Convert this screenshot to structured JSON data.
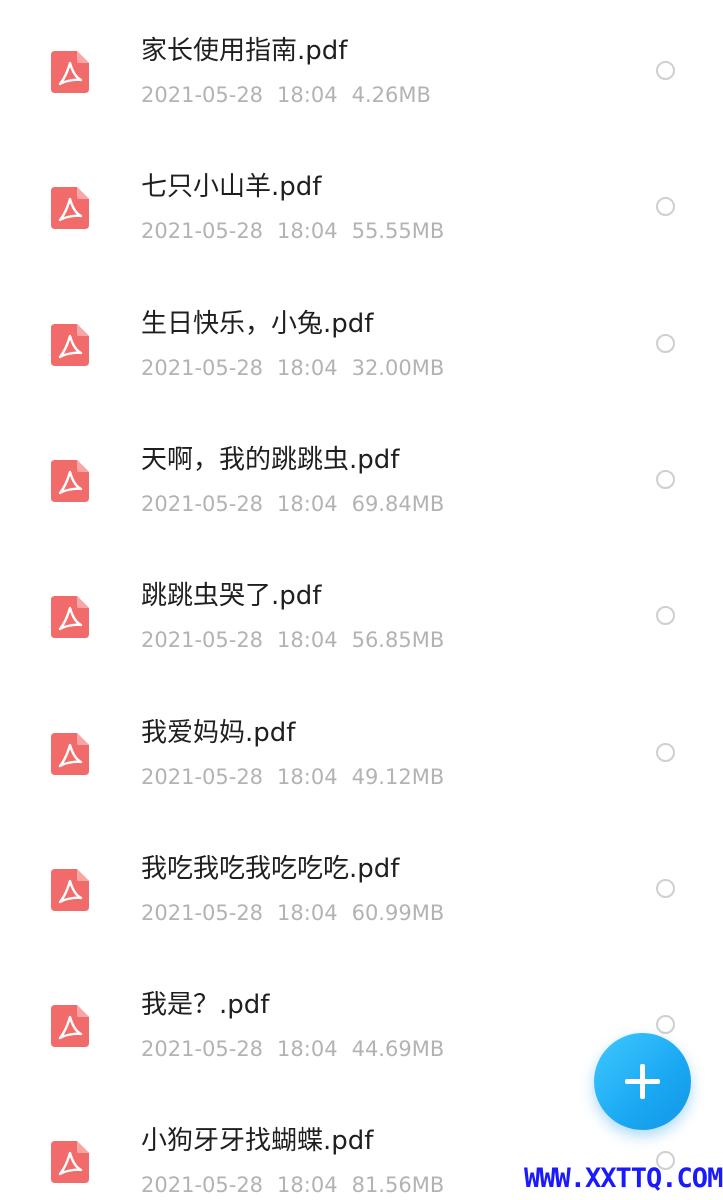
{
  "files": [
    {
      "name": "家长使用指南.pdf",
      "date": "2021-05-28",
      "time": "18:04",
      "size": "4.26MB"
    },
    {
      "name": "七只小山羊.pdf",
      "date": "2021-05-28",
      "time": "18:04",
      "size": "55.55MB"
    },
    {
      "name": "生日快乐，小兔.pdf",
      "date": "2021-05-28",
      "time": "18:04",
      "size": "32.00MB"
    },
    {
      "name": "天啊，我的跳跳虫.pdf",
      "date": "2021-05-28",
      "time": "18:04",
      "size": "69.84MB"
    },
    {
      "name": "跳跳虫哭了.pdf",
      "date": "2021-05-28",
      "time": "18:04",
      "size": "56.85MB"
    },
    {
      "name": "我爱妈妈.pdf",
      "date": "2021-05-28",
      "time": "18:04",
      "size": "49.12MB"
    },
    {
      "name": "我吃我吃我吃吃吃.pdf",
      "date": "2021-05-28",
      "time": "18:04",
      "size": "60.99MB"
    },
    {
      "name": "我是？.pdf",
      "date": "2021-05-28",
      "time": "18:04",
      "size": "44.69MB"
    },
    {
      "name": "小狗牙牙找蝴蝶.pdf",
      "date": "2021-05-28",
      "time": "18:04",
      "size": "81.56MB"
    }
  ],
  "icons": {
    "file_icon": "pdf-file-icon",
    "fab_icon": "plus-icon"
  },
  "colors": {
    "pdf_icon": "#f26b6b",
    "fab": "#1aa8f2",
    "watermark": "#1a1aff"
  },
  "watermark": "WWW.XXTTQ.COM"
}
